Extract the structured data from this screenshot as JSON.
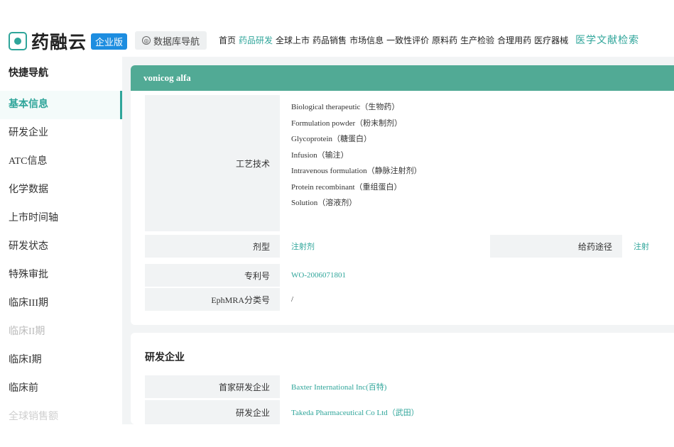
{
  "header": {
    "logo_text": "药融云",
    "logo_badge": "企业版",
    "db_nav_label": "数据库导航",
    "nav": [
      "首页",
      "药品研发",
      "全球上市",
      "药品销售",
      "市场信息",
      "一致性评价",
      "原料药",
      "生产检验",
      "合理用药",
      "医疗器械"
    ],
    "nav_active_index": 1,
    "nav_highlight": "医学文献检索",
    "accent_color": "#2fa59a"
  },
  "sidebar": {
    "title": "快捷导航",
    "items": [
      "基本信息",
      "研发企业",
      "ATC信息",
      "化学数据",
      "上市时间轴",
      "研发状态",
      "特殊审批",
      "临床III期",
      "临床II期",
      "临床I期",
      "临床前",
      "全球销售额"
    ],
    "active_index": 0
  },
  "basic": {
    "drug_name": "vonicog alfa",
    "tech_label": "工艺技术",
    "tech_items": [
      "Biological therapeutic（生物药）",
      "Formulation powder（粉末制剂）",
      "Glycoprotein（糖蛋白）",
      "Infusion（输注）",
      "Intravenous formulation（静脉注射剂）",
      "Protein recombinant（重组蛋白）",
      "Solution（溶液剂）"
    ],
    "dosage_label": "剂型",
    "dosage_value": "注射剂",
    "route_label": "给药途径",
    "route_value": "注射",
    "patent_label": "专利号",
    "patent_value": "WO-2006071801",
    "ephmra_label": "EphMRA分类号",
    "ephmra_value": "/"
  },
  "rd": {
    "title": "研发企业",
    "first_label": "首家研发企业",
    "first_value": "Baxter International Inc(百特)",
    "company_label": "研发企业",
    "company_value": "Takeda Pharmaceutical Co Ltd（武田）"
  }
}
